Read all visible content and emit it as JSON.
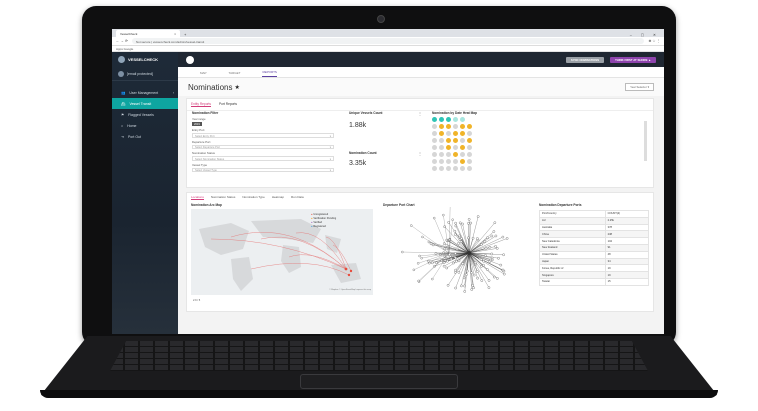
{
  "browser": {
    "tab_title": "VesselCheck",
    "tab_close": "×",
    "new_tab": "+",
    "window_controls": "–  ▢  ✕",
    "nav_icons": "←  →  ⟳",
    "not_secure": "Not secure",
    "url": "vessel-check.com/admin/vessel-transit",
    "toolbar_icons": "⊕ ☆ ⋮",
    "bookmarks": "Apps   Google"
  },
  "sidebar": {
    "brand": "VESSELCHECK",
    "user_email": "[email protected]",
    "items": [
      {
        "label": "User Management",
        "icon": "users-icon",
        "glyph": "👥",
        "chev": "›"
      },
      {
        "label": "Vessel Transit",
        "icon": "ship-icon",
        "glyph": "⛴",
        "active": true
      },
      {
        "label": "Flagged Vessels",
        "icon": "flag-icon",
        "glyph": "⚑"
      },
      {
        "label": "Home",
        "icon": "home-icon",
        "glyph": "⌂"
      },
      {
        "label": "Port Out",
        "icon": "logout-icon",
        "glyph": "⇥"
      }
    ]
  },
  "header": {
    "btn_grey": "SYNC NOMINATIONS",
    "btn_purple": "THINK FIRST AT SHORE ▲"
  },
  "module_tabs": [
    "MAP",
    "TARGET",
    "REPORTS"
  ],
  "page": {
    "title": "Nominations",
    "star": "★",
    "select_value": "Year Selector",
    "select_caret": "▾"
  },
  "filter_card": {
    "tabs": [
      "Entity Reports",
      "Port Reports"
    ],
    "section": "Nomination Filter",
    "year_label": "Year range",
    "year_chip": "2019",
    "fields": [
      {
        "label": "Entry Port",
        "placeholder": "Select Entry Port"
      },
      {
        "label": "Departure Port",
        "placeholder": "Select Departure Port"
      },
      {
        "label": "Nomination Status",
        "placeholder": "Select Nomination Status"
      },
      {
        "label": "Vessel Type",
        "placeholder": "Select Vessel Type"
      }
    ],
    "caret": "▾"
  },
  "kpis": {
    "unique_label": "Unique Vessels Count",
    "unique_value": "1.88k",
    "nomination_label": "Nomination Count",
    "nomination_value": "3.35k",
    "menu": "⋮"
  },
  "heatmap": {
    "title": "Nomination by Date Heat Map",
    "colors": {
      "teal": "#2ec4b6",
      "light_teal": "#a8e6df",
      "yellow": "#f0b429",
      "grey": "#d6d6d6"
    }
  },
  "bottom_tabs": [
    "Locations",
    "Nomination Status",
    "Nomination Type",
    "Heatmap",
    "Run Data"
  ],
  "arc_map": {
    "title": "Nomination Arc Map",
    "legend": [
      "Unregistered",
      "Verification Pending",
      "Verified",
      "Registered"
    ],
    "legend_colors": [
      "#e74c3c",
      "#f39c12",
      "#9b59b6",
      "#3498db"
    ],
    "attribution": "© Mapbox © OpenStreetMap  Improve this map",
    "zoom": "2.9 / 5"
  },
  "network": {
    "title": "Departure Port Chart"
  },
  "port_table": {
    "title": "Nomination Departure Ports",
    "header": [
      "Port/Country",
      "COUNT(d)"
    ],
    "rows": [
      [
        "AU",
        "2.25k"
      ],
      [
        "Australia",
        "378"
      ],
      [
        "China",
        "238"
      ],
      [
        "New Caledonia",
        "104"
      ],
      [
        "New Zealand",
        "91"
      ],
      [
        "United States",
        "48"
      ],
      [
        "Japan",
        "34"
      ],
      [
        "Korea, Republic of",
        "19"
      ],
      [
        "Singapore",
        "19"
      ],
      [
        "Taiwan",
        "15"
      ]
    ]
  }
}
